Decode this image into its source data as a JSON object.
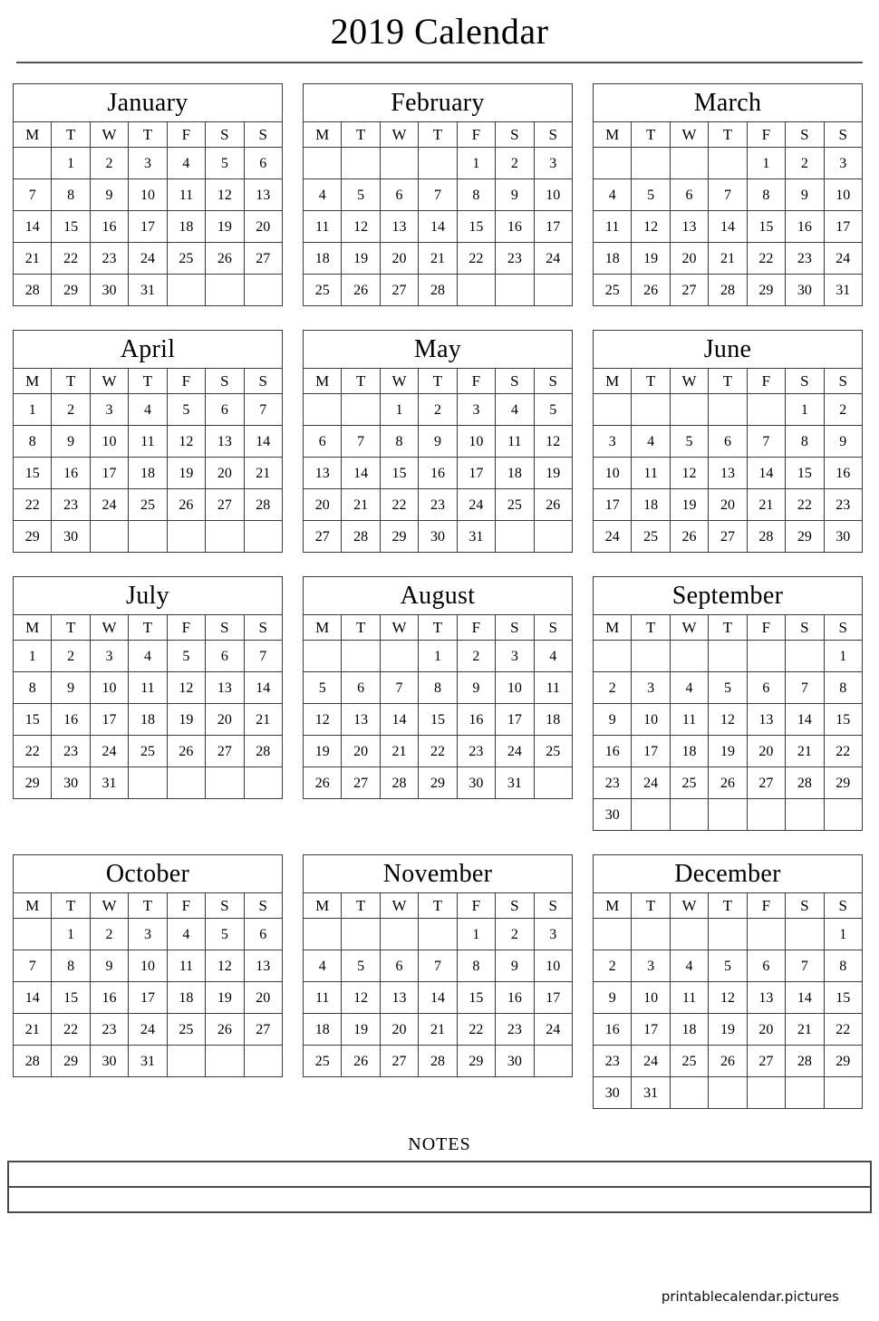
{
  "document": {
    "title": "2019 Calendar",
    "year": "2019"
  },
  "weekday_headers": [
    "M",
    "T",
    "W",
    "T",
    "F",
    "S",
    "S"
  ],
  "months": [
    {
      "name": "January",
      "weeks": [
        [
          "",
          "1",
          "2",
          "3",
          "4",
          "5",
          "6"
        ],
        [
          "7",
          "8",
          "9",
          "10",
          "11",
          "12",
          "13"
        ],
        [
          "14",
          "15",
          "16",
          "17",
          "18",
          "19",
          "20"
        ],
        [
          "21",
          "22",
          "23",
          "24",
          "25",
          "26",
          "27"
        ],
        [
          "28",
          "29",
          "30",
          "31",
          "",
          "",
          ""
        ]
      ]
    },
    {
      "name": "February",
      "weeks": [
        [
          "",
          "",
          "",
          "",
          "1",
          "2",
          "3"
        ],
        [
          "4",
          "5",
          "6",
          "7",
          "8",
          "9",
          "10"
        ],
        [
          "11",
          "12",
          "13",
          "14",
          "15",
          "16",
          "17"
        ],
        [
          "18",
          "19",
          "20",
          "21",
          "22",
          "23",
          "24"
        ],
        [
          "25",
          "26",
          "27",
          "28",
          "",
          "",
          ""
        ]
      ]
    },
    {
      "name": "March",
      "weeks": [
        [
          "",
          "",
          "",
          "",
          "1",
          "2",
          "3"
        ],
        [
          "4",
          "5",
          "6",
          "7",
          "8",
          "9",
          "10"
        ],
        [
          "11",
          "12",
          "13",
          "14",
          "15",
          "16",
          "17"
        ],
        [
          "18",
          "19",
          "20",
          "21",
          "22",
          "23",
          "24"
        ],
        [
          "25",
          "26",
          "27",
          "28",
          "29",
          "30",
          "31"
        ]
      ]
    },
    {
      "name": "April",
      "weeks": [
        [
          "1",
          "2",
          "3",
          "4",
          "5",
          "6",
          "7"
        ],
        [
          "8",
          "9",
          "10",
          "11",
          "12",
          "13",
          "14"
        ],
        [
          "15",
          "16",
          "17",
          "18",
          "19",
          "20",
          "21"
        ],
        [
          "22",
          "23",
          "24",
          "25",
          "26",
          "27",
          "28"
        ],
        [
          "29",
          "30",
          "",
          "",
          "",
          "",
          ""
        ]
      ]
    },
    {
      "name": "May",
      "weeks": [
        [
          "",
          "",
          "1",
          "2",
          "3",
          "4",
          "5"
        ],
        [
          "6",
          "7",
          "8",
          "9",
          "10",
          "11",
          "12"
        ],
        [
          "13",
          "14",
          "15",
          "16",
          "17",
          "18",
          "19"
        ],
        [
          "20",
          "21",
          "22",
          "23",
          "24",
          "25",
          "26"
        ],
        [
          "27",
          "28",
          "29",
          "30",
          "31",
          "",
          ""
        ]
      ]
    },
    {
      "name": "June",
      "weeks": [
        [
          "",
          "",
          "",
          "",
          "",
          "1",
          "2"
        ],
        [
          "3",
          "4",
          "5",
          "6",
          "7",
          "8",
          "9"
        ],
        [
          "10",
          "11",
          "12",
          "13",
          "14",
          "15",
          "16"
        ],
        [
          "17",
          "18",
          "19",
          "20",
          "21",
          "22",
          "23"
        ],
        [
          "24",
          "25",
          "26",
          "27",
          "28",
          "29",
          "30"
        ]
      ]
    },
    {
      "name": "July",
      "weeks": [
        [
          "1",
          "2",
          "3",
          "4",
          "5",
          "6",
          "7"
        ],
        [
          "8",
          "9",
          "10",
          "11",
          "12",
          "13",
          "14"
        ],
        [
          "15",
          "16",
          "17",
          "18",
          "19",
          "20",
          "21"
        ],
        [
          "22",
          "23",
          "24",
          "25",
          "26",
          "27",
          "28"
        ],
        [
          "29",
          "30",
          "31",
          "",
          "",
          "",
          ""
        ]
      ]
    },
    {
      "name": "August",
      "weeks": [
        [
          "",
          "",
          "",
          "1",
          "2",
          "3",
          "4"
        ],
        [
          "5",
          "6",
          "7",
          "8",
          "9",
          "10",
          "11"
        ],
        [
          "12",
          "13",
          "14",
          "15",
          "16",
          "17",
          "18"
        ],
        [
          "19",
          "20",
          "21",
          "22",
          "23",
          "24",
          "25"
        ],
        [
          "26",
          "27",
          "28",
          "29",
          "30",
          "31",
          ""
        ]
      ]
    },
    {
      "name": "September",
      "weeks": [
        [
          "",
          "",
          "",
          "",
          "",
          "",
          "1"
        ],
        [
          "2",
          "3",
          "4",
          "5",
          "6",
          "7",
          "8"
        ],
        [
          "9",
          "10",
          "11",
          "12",
          "13",
          "14",
          "15"
        ],
        [
          "16",
          "17",
          "18",
          "19",
          "20",
          "21",
          "22"
        ],
        [
          "23",
          "24",
          "25",
          "26",
          "27",
          "28",
          "29"
        ],
        [
          "30",
          "",
          "",
          "",
          "",
          "",
          ""
        ]
      ]
    },
    {
      "name": "October",
      "weeks": [
        [
          "",
          "1",
          "2",
          "3",
          "4",
          "5",
          "6"
        ],
        [
          "7",
          "8",
          "9",
          "10",
          "11",
          "12",
          "13"
        ],
        [
          "14",
          "15",
          "16",
          "17",
          "18",
          "19",
          "20"
        ],
        [
          "21",
          "22",
          "23",
          "24",
          "25",
          "26",
          "27"
        ],
        [
          "28",
          "29",
          "30",
          "31",
          "",
          "",
          ""
        ]
      ]
    },
    {
      "name": "November",
      "weeks": [
        [
          "",
          "",
          "",
          "",
          "1",
          "2",
          "3"
        ],
        [
          "4",
          "5",
          "6",
          "7",
          "8",
          "9",
          "10"
        ],
        [
          "11",
          "12",
          "13",
          "14",
          "15",
          "16",
          "17"
        ],
        [
          "18",
          "19",
          "20",
          "21",
          "22",
          "23",
          "24"
        ],
        [
          "25",
          "26",
          "27",
          "28",
          "29",
          "30",
          ""
        ]
      ]
    },
    {
      "name": "December",
      "weeks": [
        [
          "",
          "",
          "",
          "",
          "",
          "",
          "1"
        ],
        [
          "2",
          "3",
          "4",
          "5",
          "6",
          "7",
          "8"
        ],
        [
          "9",
          "10",
          "11",
          "12",
          "13",
          "14",
          "15"
        ],
        [
          "16",
          "17",
          "18",
          "19",
          "20",
          "21",
          "22"
        ],
        [
          "23",
          "24",
          "25",
          "26",
          "27",
          "28",
          "29"
        ],
        [
          "30",
          "31",
          "",
          "",
          "",
          "",
          ""
        ]
      ]
    }
  ],
  "notes": {
    "label": "NOTES",
    "lines": [
      "",
      ""
    ]
  },
  "footer": {
    "source": "printablecalendar.pictures"
  },
  "colors": {
    "text": "#000000",
    "grid_border": "#3c3c3c",
    "rule": "#555555",
    "notes_border": "#4a4a4a",
    "background": "#ffffff"
  }
}
